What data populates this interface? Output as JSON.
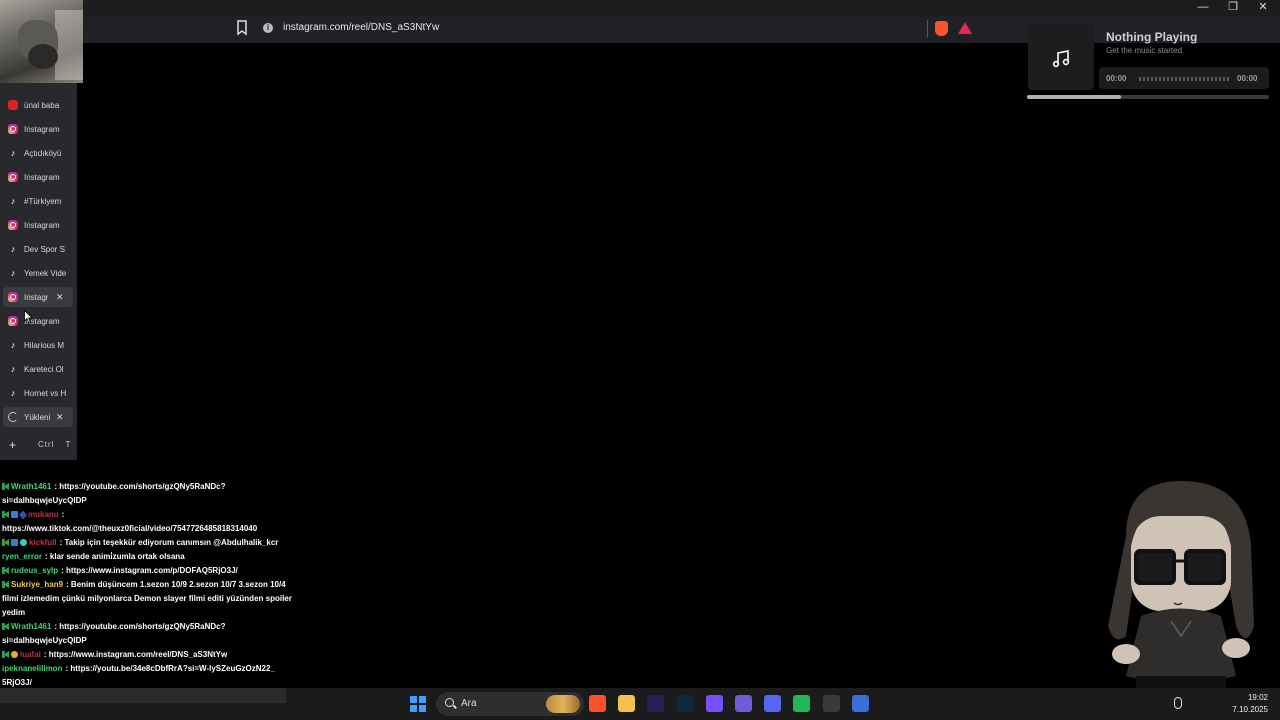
{
  "browser": {
    "url": "instagram.com/reel/DNS_aS3NtYw",
    "window_controls": [
      "—",
      "❐",
      "✕"
    ]
  },
  "tabs": [
    {
      "label": "ünal baba",
      "icon": "youtube-icon",
      "active": false
    },
    {
      "label": "Instagram",
      "icon": "instagram-icon",
      "active": false
    },
    {
      "label": "Açtıdıköyü",
      "icon": "tiktok-icon",
      "active": false
    },
    {
      "label": "Instagram",
      "icon": "instagram-icon",
      "active": false
    },
    {
      "label": "#Türkiyem",
      "icon": "tiktok-icon",
      "active": false
    },
    {
      "label": "Instagram",
      "icon": "instagram-icon",
      "active": false
    },
    {
      "label": "Dev Spor S",
      "icon": "tiktok-icon",
      "active": false
    },
    {
      "label": "Yemek Vide",
      "icon": "tiktok-icon",
      "active": false
    },
    {
      "label": "Instagr",
      "icon": "instagram-icon",
      "active": true,
      "close": "✕"
    },
    {
      "label": "Instagram",
      "icon": "instagram-icon",
      "active": false
    },
    {
      "label": "Hilarious M",
      "icon": "tiktok-icon",
      "active": false
    },
    {
      "label": "Kareteci Ol",
      "icon": "tiktok-icon",
      "active": false
    },
    {
      "label": "Hornet vs H",
      "icon": "tiktok-icon",
      "active": false
    },
    {
      "label": "Yükleni",
      "icon": "loading-spinner-icon",
      "active": true,
      "close": "✕"
    }
  ],
  "new_tab": {
    "plus": "+",
    "shortcut": "Ctrl T"
  },
  "music": {
    "title": "Nothing Playing",
    "subtitle": "Get the music started",
    "current_time": "00:00",
    "end_time": "00:00",
    "progress": 0.39
  },
  "chat": [
    {
      "user": "Wrath1461",
      "user_color": "#3fd67a",
      "badges": [
        "green"
      ],
      "text": ": https://youtube.com/shorts/gzQNy5RaNDc?si=dalhbqwjeUycQIDP"
    },
    {
      "user": "mukanu",
      "user_color": "#c0304a",
      "badges": [
        "green",
        "blue",
        "navy"
      ],
      "text": ": https://www.tiktok.com/@theuxz0ficial/video/7547726485818314040"
    },
    {
      "user": "kickfull",
      "user_color": "#c0304a",
      "badges": [
        "green",
        "blue",
        "teal"
      ],
      "text": ": Takip için teşekkür ediyorum canımsın @Abdulhalik_kcr"
    },
    {
      "user": "ryen_error",
      "user_color": "#3fd67a",
      "badges": [],
      "text": ": klar sende animi̇zumla ortak olsana"
    },
    {
      "user": "rudeus_sylp",
      "user_color": "#3fd67a",
      "badges": [
        "green"
      ],
      "text": ": https://www.instagram.com/p/DOFAQ5RjO3J/"
    },
    {
      "user": "Sukriye_han9",
      "user_color": "#f2c94c",
      "badges": [
        "green"
      ],
      "text": ": Benim düşüncem 1.sezon 10/9 2.sezon 10/7 3.sezon 10/4 filmi izlemedim çünkü milyonlarca Demon slayer filmi editi yüzünden spoiler yedim"
    },
    {
      "user": "Wrath1461",
      "user_color": "#3fd67a",
      "badges": [
        "green"
      ],
      "text": ": https://youtube.com/shorts/gzQNy5RaNDc?si=dalhbqwjeUycQIDP"
    },
    {
      "user": "luafai",
      "user_color": "#c0304a",
      "badges": [
        "green",
        "gold"
      ],
      "text": ": https://www.instagram.com/reel/DNS_aS3NtYw"
    },
    {
      "user": "ipeknanelilimon",
      "user_color": "#3fd67a",
      "badges": [],
      "text": ": https://youtu.be/34e8cDbfRrA?si=W-lySZeuGzOzN22_"
    },
    {
      "user": "",
      "user_color": "#ffffff",
      "badges": [],
      "text": "5RjO3J/"
    }
  ],
  "taskbar": {
    "search_placeholder": "Ara",
    "time": "19:02",
    "date": "7.10.2025",
    "apps": [
      {
        "name": "brave-icon",
        "color": "#fb542b"
      },
      {
        "name": "file-explorer-icon",
        "color": "#f2c14e"
      },
      {
        "name": "premiere-pro-icon",
        "color": "#2a1f5c"
      },
      {
        "name": "photoshop-icon",
        "color": "#0a2a44"
      },
      {
        "name": "obsidian-icon",
        "color": "#7c4dff"
      },
      {
        "name": "visual-studio-icon",
        "color": "#6f5bd8"
      },
      {
        "name": "discord-icon",
        "color": "#5865f2"
      },
      {
        "name": "spotify-icon",
        "color": "#1db954"
      },
      {
        "name": "steam-icon",
        "color": "#3a3a3a"
      },
      {
        "name": "brave-active-icon",
        "color": "#3a6fd8"
      }
    ]
  }
}
